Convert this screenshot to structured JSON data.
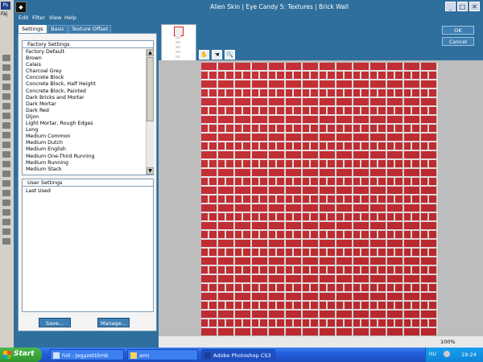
{
  "window": {
    "title": "Alien Skin | Eye Candy 5: Textures | Brick Wall",
    "minimize": "_",
    "maximize": "□",
    "close": "✕"
  },
  "photoshop": {
    "logo": "Ps",
    "menu_fragment": "Fáj"
  },
  "menu": [
    "Edit",
    "Filter",
    "View",
    "Help"
  ],
  "tabs": [
    "Settings",
    "Basic",
    "Texture Offset"
  ],
  "factory_settings": {
    "header": "Factory Settings",
    "items": [
      "Factory Default",
      "Brown",
      "Calais",
      "Charcoal Grey",
      "Concrete Block",
      "Concrete Block, Half Height",
      "Concrete Block, Painted",
      "Dark Bricks and Mortar",
      "Dark Mortar",
      "Dark Red",
      "Dijon",
      "Light Mortar, Rough Edges",
      "Long",
      "Medium Common",
      "Medium Dutch",
      "Medium English",
      "Medium One-Third Running",
      "Medium Running",
      "Medium Stack"
    ]
  },
  "user_settings": {
    "header": "User Settings",
    "items": [
      "Last Used"
    ]
  },
  "buttons": {
    "save": "Save...",
    "manage": "Manage...",
    "ok": "OK",
    "cancel": "Cancel"
  },
  "preview": {
    "zoom": "100%",
    "tools": [
      "hand-icon",
      "pan-icon",
      "zoom-icon"
    ]
  },
  "taskbar": {
    "start": "Start",
    "tasks": [
      "hid - Jegyzettömb",
      "ami",
      "Adobe Photoshop CS3"
    ],
    "language": "HU",
    "clock": "19:24"
  },
  "colors": {
    "dialog_bg": "#2f6f9d",
    "brick": "#c42a30",
    "mortar": "#e8e2e2"
  }
}
